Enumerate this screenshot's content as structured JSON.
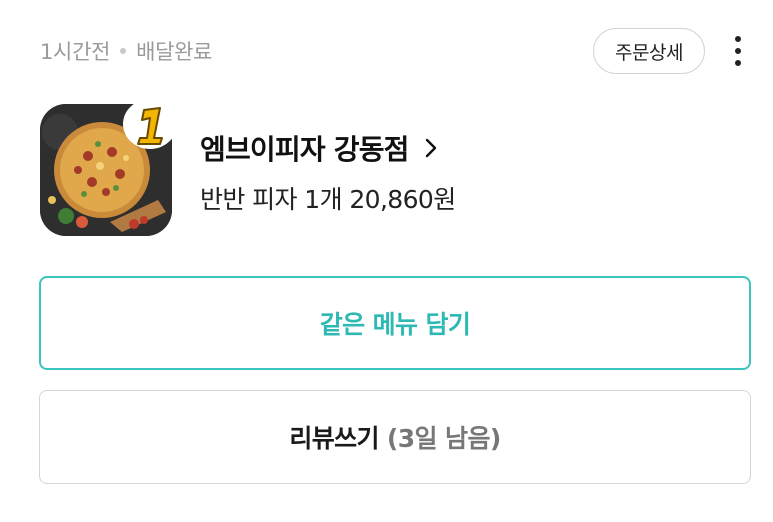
{
  "order": {
    "time_ago": "1시간전",
    "status": "배달완료",
    "detail_label": "주문상세"
  },
  "store": {
    "name": "엠브이피자 강동점",
    "badge_text": "1",
    "summary": "반반 피자 1개 20,860원"
  },
  "actions": {
    "reorder_label": "같은 메뉴 담기",
    "review_label": "리뷰쓰기",
    "review_remaining": "(3일 남음)"
  },
  "icons": {
    "more": "more-vertical-icon",
    "chevron": "chevron-right-icon"
  },
  "colors": {
    "accent": "#2fb9b4",
    "accent_border": "#3cc4bf",
    "muted": "#9b9b9b"
  }
}
